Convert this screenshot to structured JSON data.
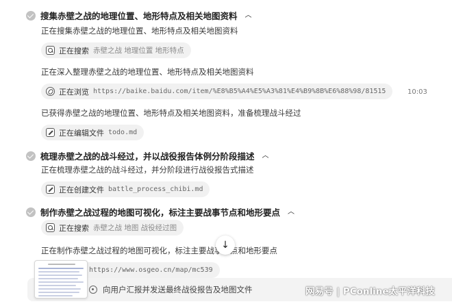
{
  "tasks": [
    {
      "title": "搜集赤壁之战的地理位置、地形特点及相关地图资料",
      "steps": [
        {
          "text": "正在搜集赤壁之战的地理位置、地形特点及相关地图资料"
        },
        {
          "chip": {
            "icon": "search-icon",
            "action": "正在搜索",
            "query": "赤壁之战  地理位置  地形特点"
          }
        },
        {
          "text": "正在深入整理赤壁之战的地理位置、地形特点及相关地图资料"
        },
        {
          "chip": {
            "icon": "browse-icon",
            "action": "正在浏览",
            "query": "https://baike.baidu.com/item/%E8%B5%A4%E5%A3%81%E4%B9%8B%E6%88%98/81515"
          },
          "time": "10:03"
        },
        {
          "text": "已获得赤壁之战的地理位置、地形特点及相关地图资料，准备梳理战斗经过"
        },
        {
          "chip": {
            "icon": "edit-icon",
            "action": "正在编辑文件",
            "query": "todo.md"
          }
        }
      ]
    },
    {
      "title": "梳理赤壁之战的战斗经过，并以战役报告体例分阶段描述",
      "steps": [
        {
          "text": "正在梳理赤壁之战的战斗经过，并分阶段进行战役报告式描述"
        },
        {
          "chip": {
            "icon": "edit-icon",
            "action": "正在创建文件",
            "query": "battle_process_chibi.md"
          }
        }
      ]
    },
    {
      "title": "制作赤壁之战过程的地图可视化，标注主要战事节点和地形要点",
      "steps": [
        {
          "chip": {
            "icon": "search-icon",
            "action": "正在搜索",
            "query": "赤壁之战  地图  战役经过图"
          }
        },
        {
          "text": "正在制作赤壁之战过程的地图可视化，标注主要战事节点和地形要点"
        },
        {
          "chip": {
            "icon": "browse-icon",
            "action": "",
            "query": "https://www.osgeo.cn/map/mc539"
          }
        }
      ]
    }
  ],
  "bottom_bar": {
    "status": "向用户汇报并发送最终战役报告及地图文件"
  },
  "scroll_button": {
    "icon": "arrow-down-icon",
    "glyph": "↓"
  },
  "watermark": "网易号 | PConline太平洋科技"
}
